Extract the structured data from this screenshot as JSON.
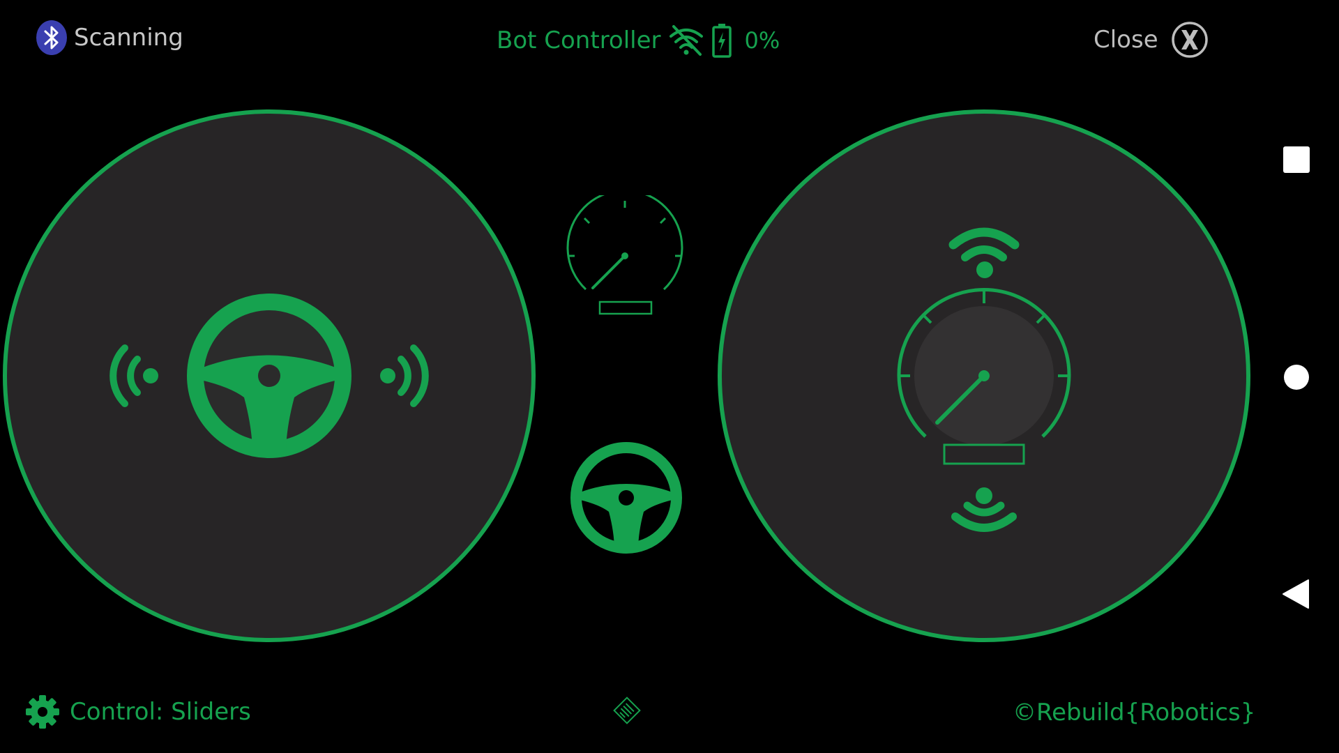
{
  "status": {
    "bluetooth_icon": "bluetooth-icon",
    "connection_label": "Scanning"
  },
  "header": {
    "title": "Bot Controller",
    "wifi_icon": "wifi-off-icon",
    "battery_icon": "battery-charging-icon",
    "battery_level": "0%"
  },
  "close": {
    "label": "Close",
    "icon": "close-x-icon"
  },
  "footer": {
    "settings_icon": "gear-icon",
    "control_label": "Control: Sliders",
    "center_icon": "sign-icon",
    "copyright": "©Rebuild{Robotics}"
  },
  "pads": {
    "left": {
      "icon": "steering-wheel-icon",
      "left_indicator_icon": "signal-waves-left-icon",
      "right_indicator_icon": "signal-waves-right-icon"
    },
    "right": {
      "icon": "speedometer-icon",
      "top_indicator_icon": "wifi-signal-icon",
      "bottom_indicator_icon": "broadcast-down-icon"
    }
  },
  "navbar": {
    "recents_icon": "square-icon",
    "home_icon": "circle-icon",
    "back_icon": "triangle-back-icon"
  },
  "colors": {
    "accent": "#16a24f",
    "pad_fill": "#272526",
    "background": "#000000",
    "text_gray": "#c8c8c8",
    "bluetooth": "#3a3fb0"
  }
}
